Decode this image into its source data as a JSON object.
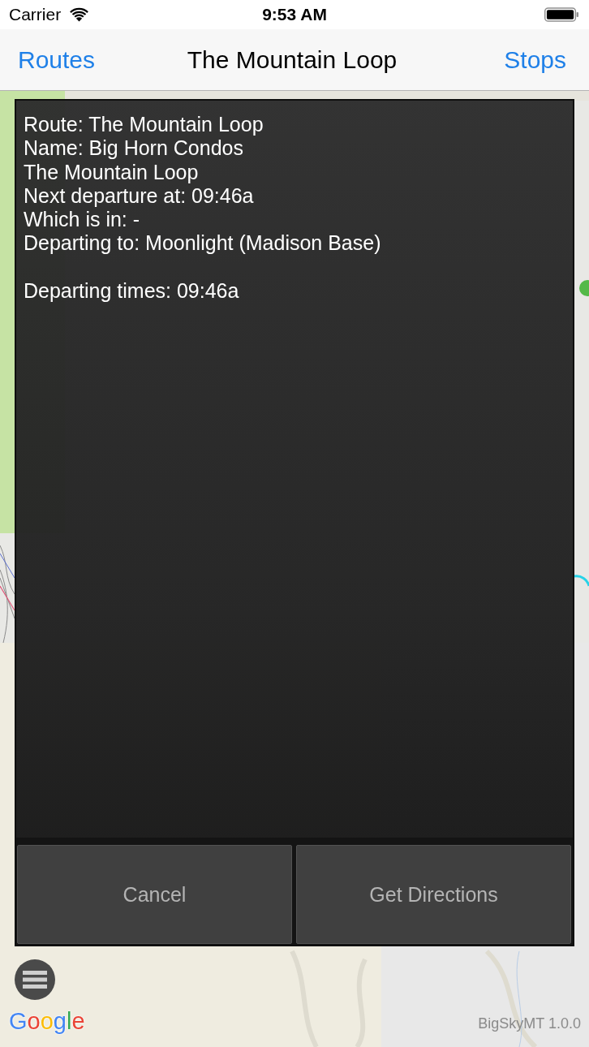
{
  "status_bar": {
    "carrier": "Carrier",
    "time": "9:53 AM"
  },
  "nav_bar": {
    "left_button": "Routes",
    "title": "The Mountain Loop",
    "right_button": "Stops"
  },
  "dialog": {
    "lines": [
      "Route: The Mountain Loop",
      "Name: Big Horn Condos",
      "The Mountain Loop",
      "Next departure at: 09:46a",
      "Which is in: -",
      "Departing to: Moonlight (Madison Base)"
    ],
    "departing_times": "Departing times: 09:46a",
    "buttons": [
      {
        "label": "Cancel"
      },
      {
        "label": "Get Directions"
      }
    ]
  },
  "map": {
    "logo": "Google",
    "version": "BigSkyMT 1.0.0"
  }
}
